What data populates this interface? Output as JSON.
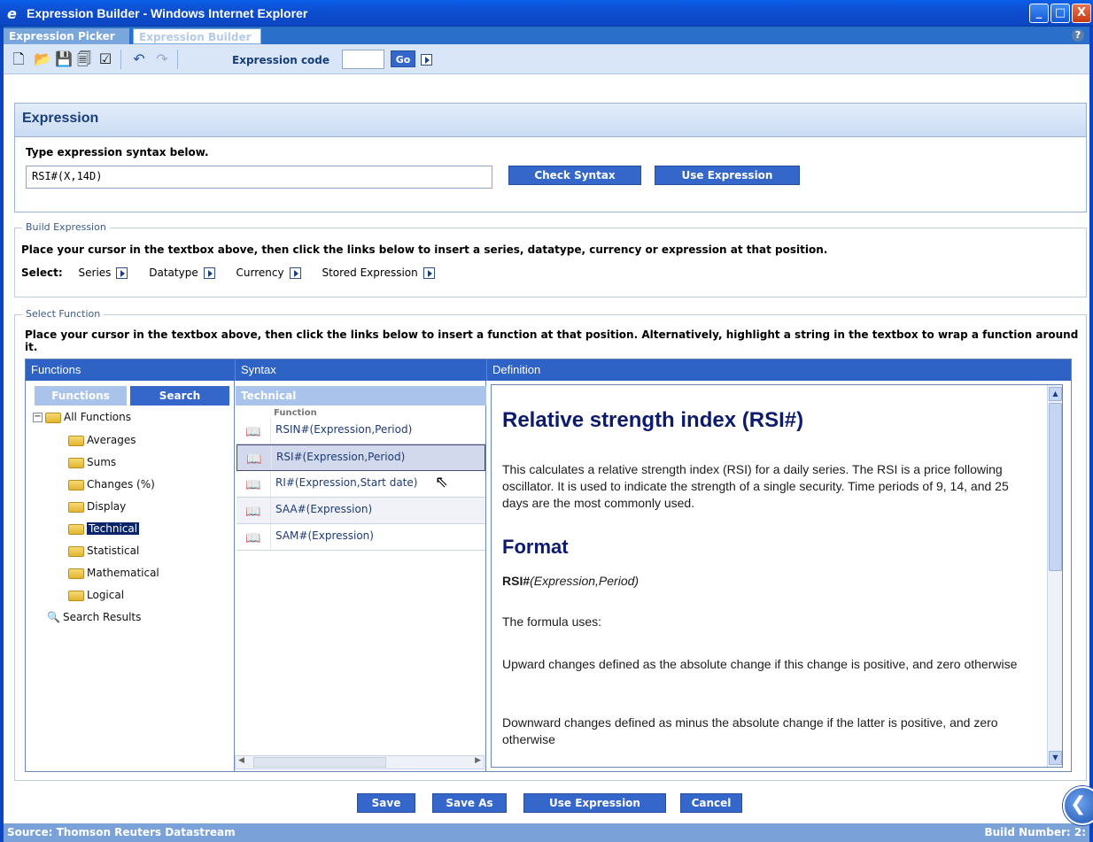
{
  "window": {
    "title": "Expression Builder - Windows Internet Explorer",
    "minimize": "_",
    "maximize": "□",
    "close": "X"
  },
  "tabs": [
    {
      "label": "Expression Picker"
    },
    {
      "label": "Expression Builder"
    }
  ],
  "toolbar": {
    "expression_code_label": "Expression code",
    "expression_code_value": "",
    "go_label": "Go"
  },
  "expression": {
    "header": "Expression",
    "subtitle": "Type expression syntax below.",
    "input_value": "RSI#(X,14D)",
    "check_syntax_label": "Check Syntax",
    "use_expression_label": "Use Expression"
  },
  "build_expression": {
    "legend": "Build Expression",
    "instruction": "Place your cursor in the textbox above, then click the links below to insert a series, datatype, currency or expression at that position.",
    "select_label": "Select:",
    "options": [
      "Series",
      "Datatype",
      "Currency",
      "Stored Expression"
    ]
  },
  "select_function": {
    "legend": "Select Function",
    "instruction": "Place your cursor in the textbox above, then click the links below to insert a function at that position. Alternatively, highlight a string in the textbox to wrap a function around it.",
    "columns": {
      "functions": "Functions",
      "syntax": "Syntax",
      "definition": "Definition"
    },
    "subtabs": {
      "functions": "Functions",
      "search": "Search",
      "category": "Technical"
    },
    "tree": {
      "root": "All Functions",
      "items": [
        "Averages",
        "Sums",
        "Changes (%)",
        "Display",
        "Technical",
        "Statistical",
        "Mathematical",
        "Logical"
      ],
      "selected": "Technical",
      "search_results": "Search Results",
      "collapse_symbol": "−"
    },
    "syntax_header": "Function",
    "syntax_rows": [
      "RSIN#(Expression,Period)",
      "RSI#(Expression,Period)",
      "RI#(Expression,Start date)",
      "SAA#(Expression)",
      "SAM#(Expression)"
    ],
    "definition": {
      "title": "Relative strength index (RSI#)",
      "description": "This calculates a relative strength index (RSI) for a daily series. The RSI is a price following oscillator. It is used to indicate the strength of a single security. Time periods of 9, 14, and 25 days are the most commonly used.",
      "format_heading": "Format",
      "format_fn": "RSI#",
      "format_args": "(Expression,Period)",
      "uses": "The formula uses:",
      "upward": "Upward changes defined as the absolute change if this change is positive, and zero otherwise",
      "downward": "Downward changes defined as minus the absolute change if the latter is positive, and zero otherwise"
    }
  },
  "buttons": {
    "save": "Save",
    "save_as": "Save As",
    "use_expression": "Use Expression",
    "cancel": "Cancel"
  },
  "footer": {
    "source": "Source: Thomson Reuters Datastream",
    "build": "Build Number: 2:"
  },
  "colors": {
    "accent": "#3566c9",
    "header_bar": "#2e62c4",
    "title_bar": "#0b45c3"
  }
}
